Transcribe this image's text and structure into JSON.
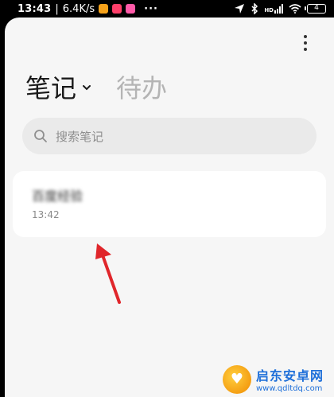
{
  "status_bar": {
    "time": "13:43",
    "net_speed": "6.4K/s",
    "more": "···",
    "battery": "4",
    "hd": "HD"
  },
  "header": {
    "notes_tab": "笔记",
    "todo_tab": "待办"
  },
  "search": {
    "placeholder": "搜索笔记"
  },
  "notes": [
    {
      "title": "百度经验",
      "time": "13:42"
    }
  ],
  "watermark": {
    "name": "启东安卓网",
    "url": "www.qdltdq.com"
  },
  "colors": {
    "accent_arrow": "#e0262b",
    "sheet_bg": "#f6f6f6"
  }
}
